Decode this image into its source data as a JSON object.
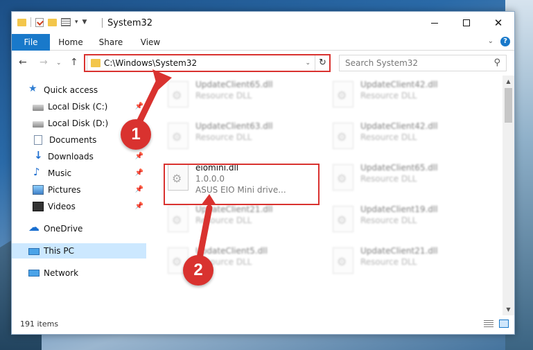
{
  "window": {
    "title": "System32"
  },
  "ribbon": {
    "tabs": [
      "File",
      "Home",
      "Share",
      "View"
    ]
  },
  "address": {
    "path": "C:\\Windows\\System32",
    "search_placeholder": "Search System32"
  },
  "sidebar": {
    "items": [
      {
        "label": "Quick access",
        "icon": "star-icon"
      },
      {
        "label": "Local Disk (C:)",
        "icon": "disk-icon",
        "pinned": true
      },
      {
        "label": "Local Disk (D:)",
        "icon": "disk-icon",
        "pinned": false
      },
      {
        "label": "Documents",
        "icon": "documents-icon",
        "pinned": true
      },
      {
        "label": "Downloads",
        "icon": "downloads-icon",
        "pinned": true
      },
      {
        "label": "Music",
        "icon": "music-icon",
        "pinned": true
      },
      {
        "label": "Pictures",
        "icon": "pictures-icon",
        "pinned": true
      },
      {
        "label": "Videos",
        "icon": "videos-icon",
        "pinned": true
      },
      {
        "label": "OneDrive",
        "icon": "onedrive-icon"
      },
      {
        "label": "This PC",
        "icon": "pc-icon",
        "selected": true
      },
      {
        "label": "Network",
        "icon": "network-icon"
      }
    ]
  },
  "files": [
    {
      "name": "UpdateClient65.dll",
      "type": "Resource DLL",
      "blurred": true
    },
    {
      "name": "UpdateClient42.dll",
      "type": "Resource DLL",
      "blurred": true
    },
    {
      "name": "UpdateClient63.dll",
      "type": "Resource DLL",
      "blurred": true
    },
    {
      "name": "UpdateClient42.dll",
      "type": "Resource DLL",
      "blurred": true
    },
    {
      "name": "eiomini.dll",
      "version": "1.0.0.0",
      "description": "ASUS EIO Mini drive...",
      "blurred": false
    },
    {
      "name": "UpdateClient65.dll",
      "type": "Resource DLL",
      "blurred": true
    },
    {
      "name": "UpdateClient21.dll",
      "type": "Resource DLL",
      "blurred": true
    },
    {
      "name": "UpdateClient19.dll",
      "type": "Resource DLL",
      "blurred": true
    },
    {
      "name": "UpdateClient5.dll",
      "type": "Resource DLL",
      "blurred": true
    },
    {
      "name": "UpdateClient21.dll",
      "type": "Resource DLL",
      "blurred": true
    }
  ],
  "status": {
    "item_count": "191 items"
  },
  "annotations": {
    "badge1": "1",
    "badge2": "2",
    "color": "#d9322f"
  }
}
